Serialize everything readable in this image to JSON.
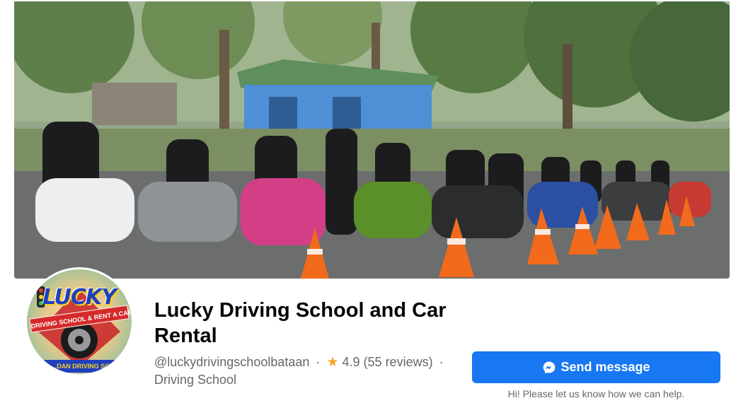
{
  "page": {
    "name": "Lucky Driving School and Car Rental",
    "username": "@luckydrivingschoolbataan",
    "separator": "·",
    "rating": "4.9",
    "reviews": "(55 reviews)",
    "category": "Driving School"
  },
  "logo": {
    "word": "LUCKY",
    "banner": "DRIVING SCHOOL & RENT A CAR",
    "bottom": "...DAN DRIVING SCH"
  },
  "actions": {
    "send_message_label": "Send message",
    "helper_text": "Hi! Please let us know how we can help."
  },
  "icons": {
    "rating": "star-icon",
    "send": "messenger-icon"
  },
  "colors": {
    "accent": "#1877f2",
    "star": "#f5a623",
    "secondary_text": "#65676b"
  }
}
